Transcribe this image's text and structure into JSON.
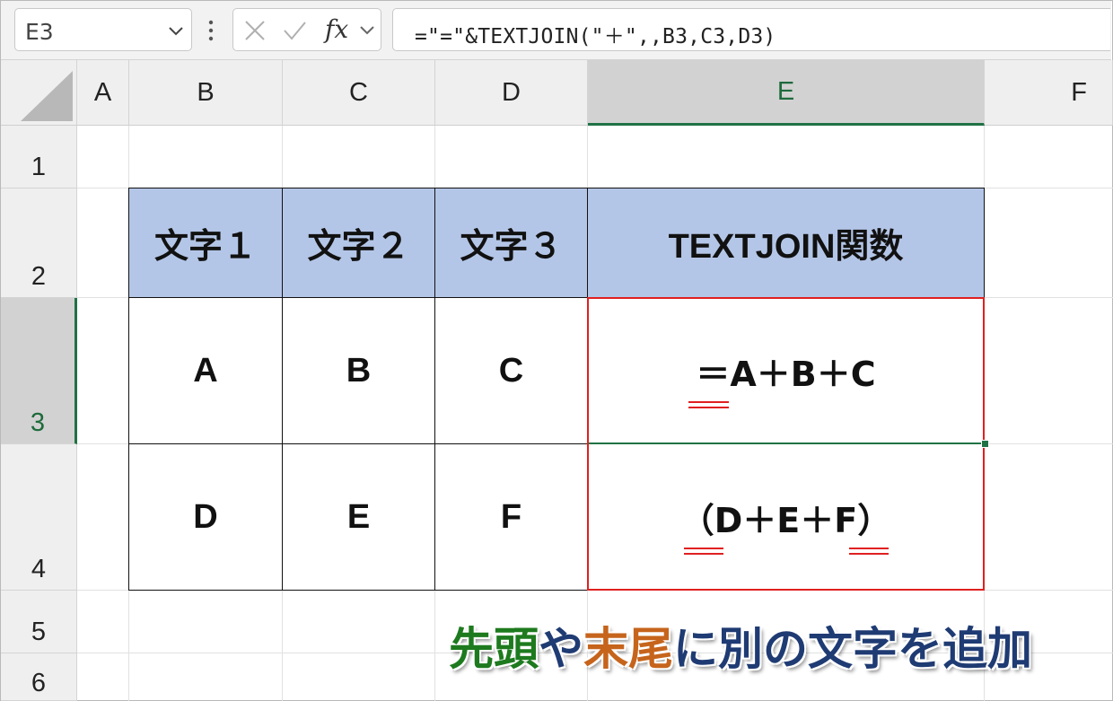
{
  "formula_bar": {
    "name_box": "E3",
    "formula": "=\"=\"&TEXTJOIN(\"＋\",,B3,C3,D3)",
    "fx_label": "fx"
  },
  "columns": [
    "A",
    "B",
    "C",
    "D",
    "E",
    "F"
  ],
  "selected_column": "E",
  "rows": [
    "1",
    "2",
    "3",
    "4",
    "5",
    "6"
  ],
  "selected_row": "3",
  "table": {
    "headers": [
      "文字１",
      "文字２",
      "文字３",
      "TEXTJOIN関数"
    ],
    "rows": [
      [
        "A",
        "B",
        "C",
        "＝A＋B＋C"
      ],
      [
        "D",
        "E",
        "F",
        "（D＋E＋F）"
      ]
    ]
  },
  "caption": {
    "parts": [
      {
        "text": "先頭",
        "color": "#1e7a1e"
      },
      {
        "text": "や",
        "color": "#1f3b73"
      },
      {
        "text": "末尾",
        "color": "#c6641c"
      },
      {
        "text": "に別の文字を追加",
        "color": "#1f3b73"
      }
    ]
  },
  "colors": {
    "header_fill": "#b4c6e7",
    "highlight_red": "#e02020",
    "selection_green": "#1f7244"
  }
}
